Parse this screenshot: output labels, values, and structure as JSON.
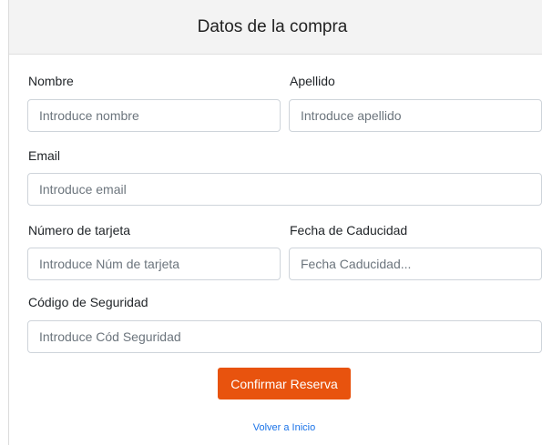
{
  "header": {
    "title": "Datos de la compra"
  },
  "form": {
    "nombre": {
      "label": "Nombre",
      "placeholder": "Introduce nombre",
      "value": ""
    },
    "apellido": {
      "label": "Apellido",
      "placeholder": "Introduce apellido",
      "value": ""
    },
    "email": {
      "label": "Email",
      "placeholder": "Introduce email",
      "value": ""
    },
    "tarjeta": {
      "label": "Número de tarjeta",
      "placeholder": "Introduce Núm de tarjeta",
      "value": ""
    },
    "caducidad": {
      "label": "Fecha de Caducidad",
      "placeholder": "Fecha Caducidad...",
      "value": ""
    },
    "seguridad": {
      "label": "Código de Seguridad",
      "placeholder": "Introduce Cód Seguridad",
      "value": ""
    }
  },
  "actions": {
    "confirm_label": "Confirmar Reserva",
    "back_link_label": "Volver a Inicio"
  },
  "colors": {
    "accent_button": "#e8530e",
    "link": "#1a73e8",
    "header_bg": "#f3f3f3"
  }
}
